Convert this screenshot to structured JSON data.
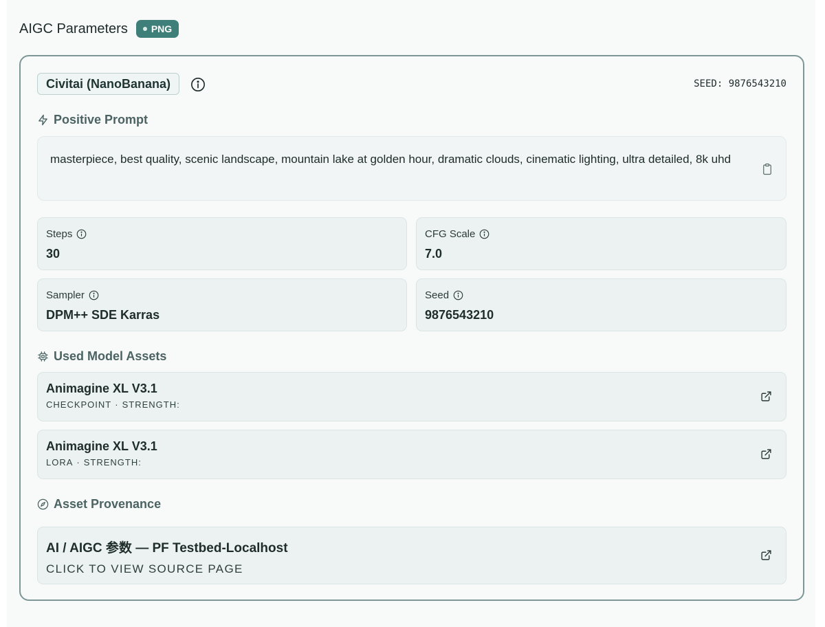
{
  "header": {
    "title": "AIGC Parameters",
    "badge": "PNG"
  },
  "card": {
    "source": "Civitai (NanoBanana)",
    "seed_label": "SEED:",
    "seed_value": "9876543210"
  },
  "prompt": {
    "section_title": "Positive Prompt",
    "text": "masterpiece, best quality, scenic landscape, mountain lake at golden hour, dramatic clouds, cinematic lighting, ultra detailed, 8k uhd"
  },
  "params": {
    "steps": {
      "label": "Steps",
      "value": "30"
    },
    "cfg": {
      "label": "CFG Scale",
      "value": "7.0"
    },
    "sampler": {
      "label": "Sampler",
      "value": "DPM++ SDE Karras"
    },
    "seed": {
      "label": "Seed",
      "value": "9876543210"
    }
  },
  "assets": {
    "section_title": "Used Model Assets",
    "items": [
      {
        "name": "Animagine XL V3.1",
        "type": "CHECKPOINT",
        "sep": "·",
        "strength_label": "STRENGTH:"
      },
      {
        "name": "Animagine XL V3.1",
        "type": "LORA",
        "sep": "·",
        "strength_label": "STRENGTH:"
      }
    ]
  },
  "provenance": {
    "section_title": "Asset Provenance",
    "title": "AI / AIGC 参数 — PF Testbed-Localhost",
    "subtitle": "CLICK TO VIEW SOURCE PAGE"
  },
  "colors": {
    "accent": "#3f7f79",
    "card_border": "#7d9796",
    "section_title": "#4b6362",
    "tile_bg": "#ecf2f2"
  },
  "icons": {
    "source_info": "info-icon",
    "prompt": "lightning-icon",
    "copy": "clipboard-icon",
    "assets": "chip-icon",
    "provenance": "compass-icon",
    "open": "external-link-icon"
  }
}
